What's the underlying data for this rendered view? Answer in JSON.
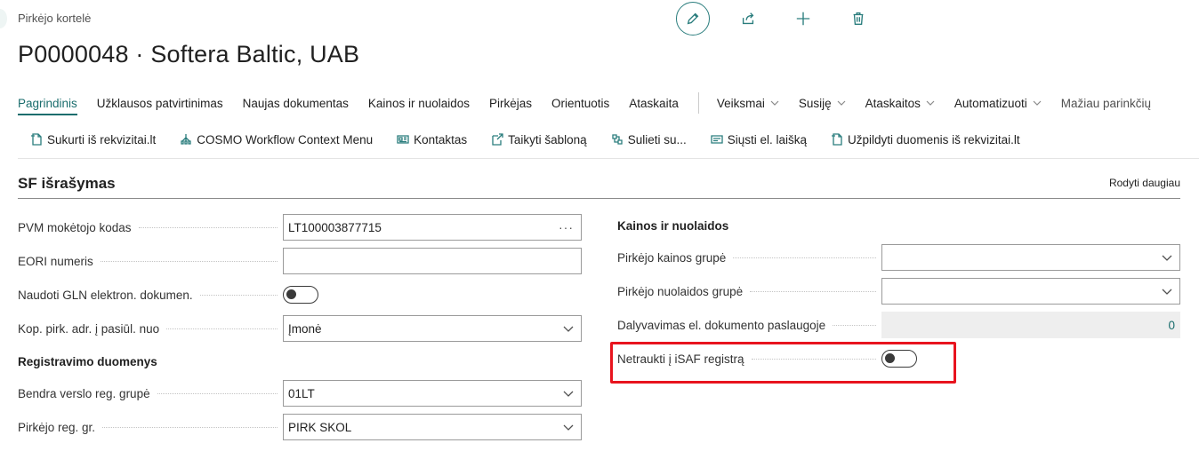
{
  "header": {
    "breadcrumb": "Pirkėjo kortelė",
    "title": "P0000048 · Softera Baltic, UAB"
  },
  "actions": [
    {
      "name": "edit-button",
      "icon": "pencil-icon"
    },
    {
      "name": "share-button",
      "icon": "share-icon"
    },
    {
      "name": "new-button",
      "icon": "plus-icon"
    },
    {
      "name": "delete-button",
      "icon": "trash-icon"
    }
  ],
  "nav": {
    "items": [
      {
        "label": "Pagrindinis",
        "active": true
      },
      {
        "label": "Užklausos patvirtinimas"
      },
      {
        "label": "Naujas dokumentas"
      },
      {
        "label": "Kainos ir nuolaidos"
      },
      {
        "label": "Pirkėjas"
      },
      {
        "label": "Orientuotis"
      },
      {
        "label": "Ataskaita"
      }
    ],
    "menus": [
      {
        "label": "Veiksmai"
      },
      {
        "label": "Susiję"
      },
      {
        "label": "Ataskaitos"
      },
      {
        "label": "Automatizuoti"
      }
    ],
    "more": "Mažiau parinkčių"
  },
  "toolbar": [
    {
      "label": "Sukurti iš rekvizitai.lt",
      "icon": "document-new-icon"
    },
    {
      "label": "COSMO Workflow Context Menu",
      "icon": "workflow-icon"
    },
    {
      "label": "Kontaktas",
      "icon": "contact-card-icon"
    },
    {
      "label": "Taikyti šabloną",
      "icon": "apply-template-icon"
    },
    {
      "label": "Sulieti su...",
      "icon": "merge-icon"
    },
    {
      "label": "Siųsti el. laišką",
      "icon": "email-icon"
    },
    {
      "label": "Užpildyti duomenis iš rekvizitai.lt",
      "icon": "document-fill-icon"
    }
  ],
  "section": {
    "title": "SF išrašymas",
    "show_more": "Rodyti daugiau"
  },
  "left": {
    "vat": {
      "label": "PVM mokėtojo kodas",
      "value": "LT100003877715",
      "suffix": "···"
    },
    "eori": {
      "label": "EORI numeris",
      "value": ""
    },
    "gln": {
      "label": "Naudoti GLN elektron. dokumen.",
      "state": "off"
    },
    "copy_addr": {
      "label": "Kop. pirk. adr. į pasiūl. nuo",
      "value": "Įmonė"
    },
    "reg_heading": "Registravimo duomenys",
    "gen_bus": {
      "label": "Bendra verslo reg. grupė",
      "value": "01LT"
    },
    "cust_posting": {
      "label": "Pirkėjo reg. gr.",
      "value": "PIRK SKOL"
    }
  },
  "right": {
    "heading": "Kainos ir nuolaidos",
    "price_group": {
      "label": "Pirkėjo kainos grupė",
      "value": ""
    },
    "disc_group": {
      "label": "Pirkėjo nuolaidos grupė",
      "value": ""
    },
    "e_doc": {
      "label": "Dalyvavimas el. dokumento paslaugoje",
      "value": "0"
    },
    "isaf": {
      "label": "Netraukti į iSAF registrą",
      "state": "off"
    }
  },
  "colors": {
    "accent": "#1a6d6d",
    "highlight": "#e8141e"
  }
}
